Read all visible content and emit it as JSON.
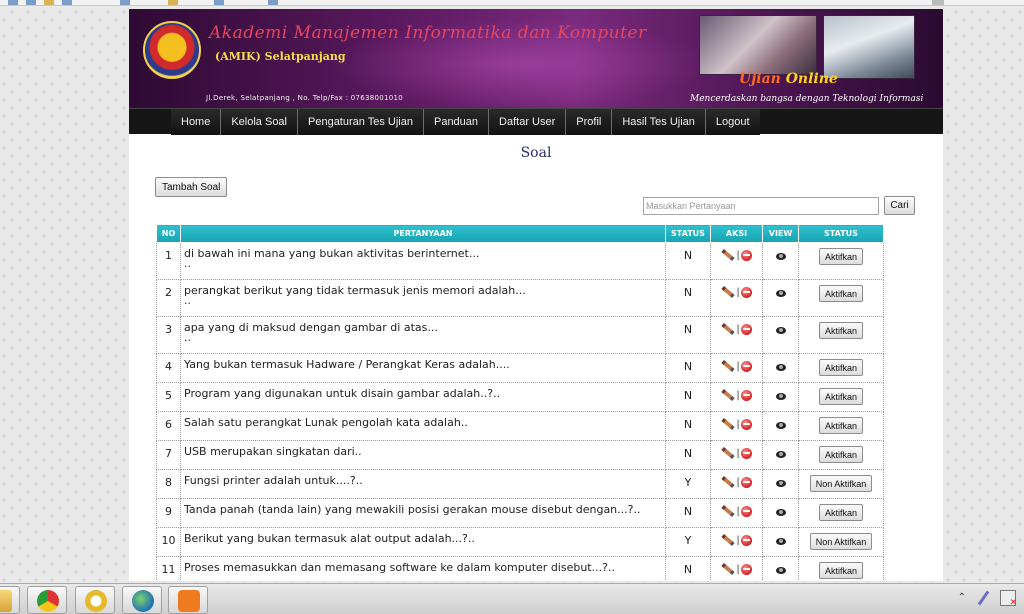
{
  "header": {
    "title": "Akademi Manajemen Informatika dan Komputer",
    "subtitle": "(AMIK) Selatpanjang",
    "address": "Jl.Derek, Selatpanjang , No.  Telp/Fax : 07638001010",
    "online_word1": "Ujian",
    "online_word2": "Online",
    "slogan": "Mencerdaskan bangsa dengan Teknologi Informasi"
  },
  "nav": {
    "items": [
      "Home",
      "Kelola Soal",
      "Pengaturan Tes Ujian",
      "Panduan",
      "Daftar User",
      "Profil",
      "Hasil Tes Ujian",
      "Logout"
    ]
  },
  "page": {
    "heading": "Soal",
    "add_button": "Tambah Soal",
    "search_placeholder": "Masukkan Pertanyaan",
    "search_button": "Cari"
  },
  "table": {
    "headers": {
      "no": "NO",
      "question": "PERTANYAAN",
      "status": "STATUS",
      "action": "AKSI",
      "view": "VIEW",
      "toggle": "STATUS"
    },
    "rows": [
      {
        "no": "1",
        "question": "di bawah ini mana yang  bukan aktivitas berinternet...",
        "cont": "..",
        "status": "N",
        "button": "Aktifkan"
      },
      {
        "no": "2",
        "question": "perangkat berikut yang tidak termasuk jenis memori adalah...",
        "cont": "..",
        "status": "N",
        "button": "Aktifkan"
      },
      {
        "no": "3",
        "question": "apa yang di maksud dengan gambar di atas...",
        "cont": "..",
        "status": "N",
        "button": "Aktifkan"
      },
      {
        "no": "4",
        "question": "Yang bukan termasuk Hadware / Perangkat Keras adalah....",
        "cont": "",
        "status": "N",
        "button": "Aktifkan"
      },
      {
        "no": "5",
        "question": "Program yang digunakan untuk disain gambar adalah..?..",
        "cont": "",
        "status": "N",
        "button": "Aktifkan"
      },
      {
        "no": "6",
        "question": "Salah satu perangkat Lunak pengolah kata adalah..",
        "cont": "",
        "status": "N",
        "button": "Aktifkan"
      },
      {
        "no": "7",
        "question": "USB merupakan singkatan dari..",
        "cont": "",
        "status": "N",
        "button": "Aktifkan"
      },
      {
        "no": "8",
        "question": "Fungsi printer adalah untuk....?..",
        "cont": "",
        "status": "Y",
        "button": "Non Aktifkan"
      },
      {
        "no": "9",
        "question": "Tanda panah (tanda lain) yang mewakili posisi gerakan mouse disebut dengan...?..",
        "cont": "",
        "status": "N",
        "button": "Aktifkan"
      },
      {
        "no": "10",
        "question": "Berikut yang bukan termasuk alat output adalah...?..",
        "cont": "",
        "status": "Y",
        "button": "Non Aktifkan"
      },
      {
        "no": "11",
        "question": "Proses memasukkan dan memasang software ke dalam komputer disebut...?..",
        "cont": "",
        "status": "N",
        "button": "Aktifkan"
      }
    ]
  },
  "taskbar": {
    "apps": [
      "windows-explorer-icon",
      "chrome-icon",
      "opera-icon",
      "globe-icon",
      "xampp-icon"
    ]
  }
}
